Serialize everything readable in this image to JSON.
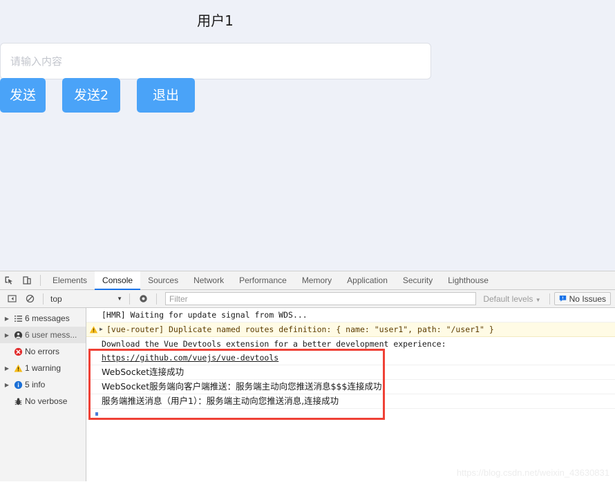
{
  "app": {
    "title": "用户1",
    "input": {
      "value": "",
      "placeholder": "请输入内容"
    },
    "buttons": [
      {
        "label": "发送",
        "name": "send-button"
      },
      {
        "label": "发送2",
        "name": "send2-button"
      },
      {
        "label": "退出",
        "name": "exit-button"
      }
    ],
    "accent_color": "#4aa3f8",
    "background_color": "#eef1f8"
  },
  "devtools": {
    "toolbar_icons": [
      {
        "name": "inspect-element-icon"
      },
      {
        "name": "device-toolbar-icon"
      }
    ],
    "tabs": [
      {
        "label": "Elements",
        "active": false
      },
      {
        "label": "Console",
        "active": true
      },
      {
        "label": "Sources",
        "active": false
      },
      {
        "label": "Network",
        "active": false
      },
      {
        "label": "Performance",
        "active": false
      },
      {
        "label": "Memory",
        "active": false
      },
      {
        "label": "Application",
        "active": false
      },
      {
        "label": "Security",
        "active": false
      },
      {
        "label": "Lighthouse",
        "active": false
      }
    ],
    "active_tab_underline_color": "#1a73e8",
    "filterbar": {
      "sidebar_toggle_icon": "sidebar-toggle-icon",
      "clear_console_icon": "clear-console-icon",
      "context": "top",
      "context_caret": "▼",
      "eye_icon": "live-expression-eye-icon",
      "filter_value": "",
      "filter_placeholder": "Filter",
      "levels_label": "Default levels",
      "levels_caret": "▼",
      "issues_label": "No Issues",
      "issues_icon": "issues-bubble-icon"
    },
    "sidebar": [
      {
        "label": "6 messages",
        "icon": "list-icon",
        "arrow": "▶",
        "selected": false
      },
      {
        "label": "6 user mess...",
        "icon": "user-icon",
        "arrow": "▶",
        "selected": true
      },
      {
        "label": "No errors",
        "icon": "error-icon",
        "arrow": "",
        "selected": false
      },
      {
        "label": "1 warning",
        "icon": "warning-icon",
        "arrow": "▶",
        "selected": false
      },
      {
        "label": "5 info",
        "icon": "info-icon",
        "arrow": "▶",
        "selected": false
      },
      {
        "label": "No verbose",
        "icon": "verbose-bug-icon",
        "arrow": "",
        "selected": false
      }
    ],
    "console_logs": [
      {
        "level": "info",
        "text": "[HMR] Waiting for update signal from WDS...",
        "arrow": "",
        "cjk": false
      },
      {
        "level": "warning",
        "text": "[vue-router] Duplicate named routes definition: { name: \"user1\", path: \"/user1\" }",
        "arrow": "▶",
        "cjk": false
      },
      {
        "level": "info",
        "text": "Download the Vue Devtools extension for a better development experience:",
        "arrow": "",
        "cjk": false
      },
      {
        "level": "link",
        "text": "https://github.com/vuejs/vue-devtools",
        "arrow": "",
        "cjk": false
      },
      {
        "level": "info",
        "text": "WebSocket连接成功",
        "arrow": "",
        "cjk": true
      },
      {
        "level": "info",
        "text": "WebSocket服务端向客户端推送：服务端主动向您推送消息$$$连接成功",
        "arrow": "",
        "cjk": true
      },
      {
        "level": "info",
        "text": "服务端推送消息（用户1）：服务端主动向您推送消息,连接成功",
        "arrow": "",
        "cjk": true
      }
    ],
    "annotation_box_color": "#ef4136"
  },
  "watermark": "https://blog.csdn.net/weixin_43630831"
}
